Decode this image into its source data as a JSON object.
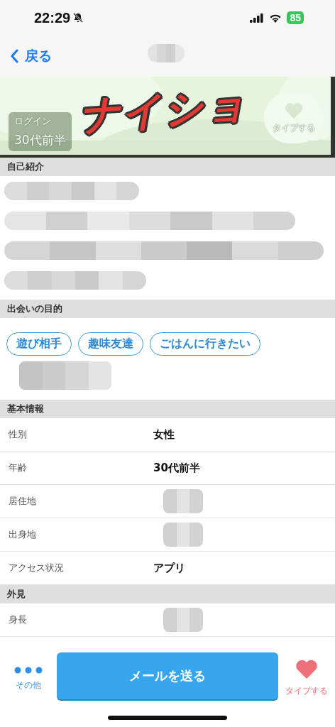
{
  "status_bar": {
    "time": "22:29",
    "silent": true,
    "battery": "85"
  },
  "nav": {
    "back": "戻る",
    "title_redacted": true
  },
  "photo": {
    "kind": "picture",
    "login": "ログイン",
    "age": "30代前半",
    "like": "タイプする",
    "sticker": "ナイショ"
  },
  "sections": [
    {
      "title": "自己紹介",
      "kind": "text",
      "redacted": true
    },
    {
      "title": "出会いの目的",
      "kind": "tags",
      "tags": [
        "遊び相手",
        "趣味友達",
        "ごはんに行きたい"
      ],
      "redacted": true
    },
    {
      "title": "基本情報",
      "kind": "rows",
      "rows": [
        {
          "label": "性別",
          "value": "女性"
        },
        {
          "label": "年齢",
          "value": "30代前半"
        },
        {
          "label": "居住地",
          "redacted": true
        },
        {
          "label": "出身地",
          "redacted": true
        },
        {
          "label": "アクセス状況",
          "value": "アプリ"
        }
      ]
    },
    {
      "title": "外見",
      "kind": "rows",
      "rows": [
        {
          "label": "身長",
          "redacted": true
        }
      ]
    }
  ],
  "bottom_bar": {
    "more": "その他",
    "send": "メールを送る",
    "like": "タイプする"
  }
}
